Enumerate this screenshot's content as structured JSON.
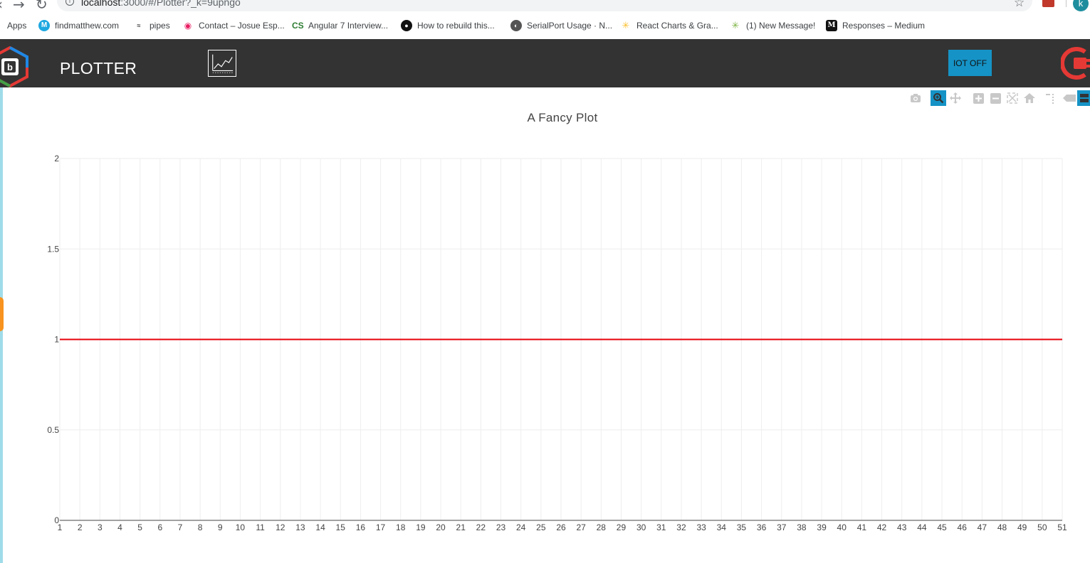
{
  "browser": {
    "url": {
      "host": "localhost",
      "rest": ":3000/#/Plotter?_k=9upngo"
    },
    "profile_initial": "k",
    "bookmarks": [
      {
        "label": "Apps",
        "icon": "apps-grid-icon",
        "color": "#4285f4"
      },
      {
        "label": "findmatthew.com",
        "icon": "findmatthew-favicon",
        "color": "#29b6f6"
      },
      {
        "label": "pipes",
        "icon": "pipes-favicon",
        "color": "#333333"
      },
      {
        "label": "Contact – Josue Esp...",
        "icon": "contact-favicon",
        "color": "#e91e63"
      },
      {
        "label": "Angular 7 Interview...",
        "icon": "cs-favicon",
        "color": "#2e7d32"
      },
      {
        "label": "How to rebuild this...",
        "icon": "github-icon",
        "color": "#000000"
      },
      {
        "label": "SerialPort Usage · N...",
        "icon": "serialport-favicon",
        "color": "#333333"
      },
      {
        "label": "React Charts & Gra...",
        "icon": "react-charts-favicon",
        "color": "#fbc02d"
      },
      {
        "label": "(1) New Message!",
        "icon": "message-favicon",
        "color": "#7cb342"
      },
      {
        "label": "Responses – Medium",
        "icon": "medium-icon",
        "color": "#000000"
      }
    ]
  },
  "header": {
    "title": "PLOTTER",
    "iot_button": "IOT OFF"
  },
  "modebar": {
    "buttons": [
      {
        "name": "camera-icon",
        "active": false
      },
      {
        "name": "zoom-icon",
        "active": true
      },
      {
        "name": "pan-icon",
        "active": false
      },
      {
        "name": "zoom-in-icon",
        "active": false
      },
      {
        "name": "zoom-out-icon",
        "active": false
      },
      {
        "name": "autoscale-icon",
        "active": false
      },
      {
        "name": "home-icon",
        "active": false
      },
      {
        "name": "spike-lines-icon",
        "active": false
      },
      {
        "name": "hover-closest-icon",
        "active": false
      },
      {
        "name": "hover-compare-icon",
        "active": true
      }
    ]
  },
  "chart_data": {
    "type": "line",
    "title": "A Fancy Plot",
    "xlabel": "",
    "ylabel": "",
    "xlim": [
      1,
      51
    ],
    "ylim": [
      0,
      2
    ],
    "x_ticks": [
      1,
      2,
      3,
      4,
      5,
      6,
      7,
      8,
      9,
      10,
      11,
      12,
      13,
      14,
      15,
      16,
      17,
      18,
      19,
      20,
      21,
      22,
      23,
      24,
      25,
      26,
      27,
      28,
      29,
      30,
      31,
      32,
      33,
      34,
      35,
      36,
      37,
      38,
      39,
      40,
      41,
      42,
      43,
      44,
      45,
      46,
      47,
      48,
      49,
      50,
      51
    ],
    "y_ticks": [
      "0",
      "0.5",
      "1",
      "1.5",
      "2"
    ],
    "grid": true,
    "series": [
      {
        "color": "#e8000b",
        "x": [
          1,
          2,
          3,
          4,
          5,
          6,
          7,
          8,
          9,
          10,
          11,
          12,
          13,
          14,
          15,
          16,
          17,
          18,
          19,
          20,
          21,
          22,
          23,
          24,
          25,
          26,
          27,
          28,
          29,
          30,
          31,
          32,
          33,
          34,
          35,
          36,
          37,
          38,
          39,
          40,
          41,
          42,
          43,
          44,
          45,
          46,
          47,
          48,
          49,
          50,
          51
        ],
        "y": [
          1,
          1,
          1,
          1,
          1,
          1,
          1,
          1,
          1,
          1,
          1,
          1,
          1,
          1,
          1,
          1,
          1,
          1,
          1,
          1,
          1,
          1,
          1,
          1,
          1,
          1,
          1,
          1,
          1,
          1,
          1,
          1,
          1,
          1,
          1,
          1,
          1,
          1,
          1,
          1,
          1,
          1,
          1,
          1,
          1,
          1,
          1,
          1,
          1,
          1,
          1
        ]
      }
    ]
  }
}
